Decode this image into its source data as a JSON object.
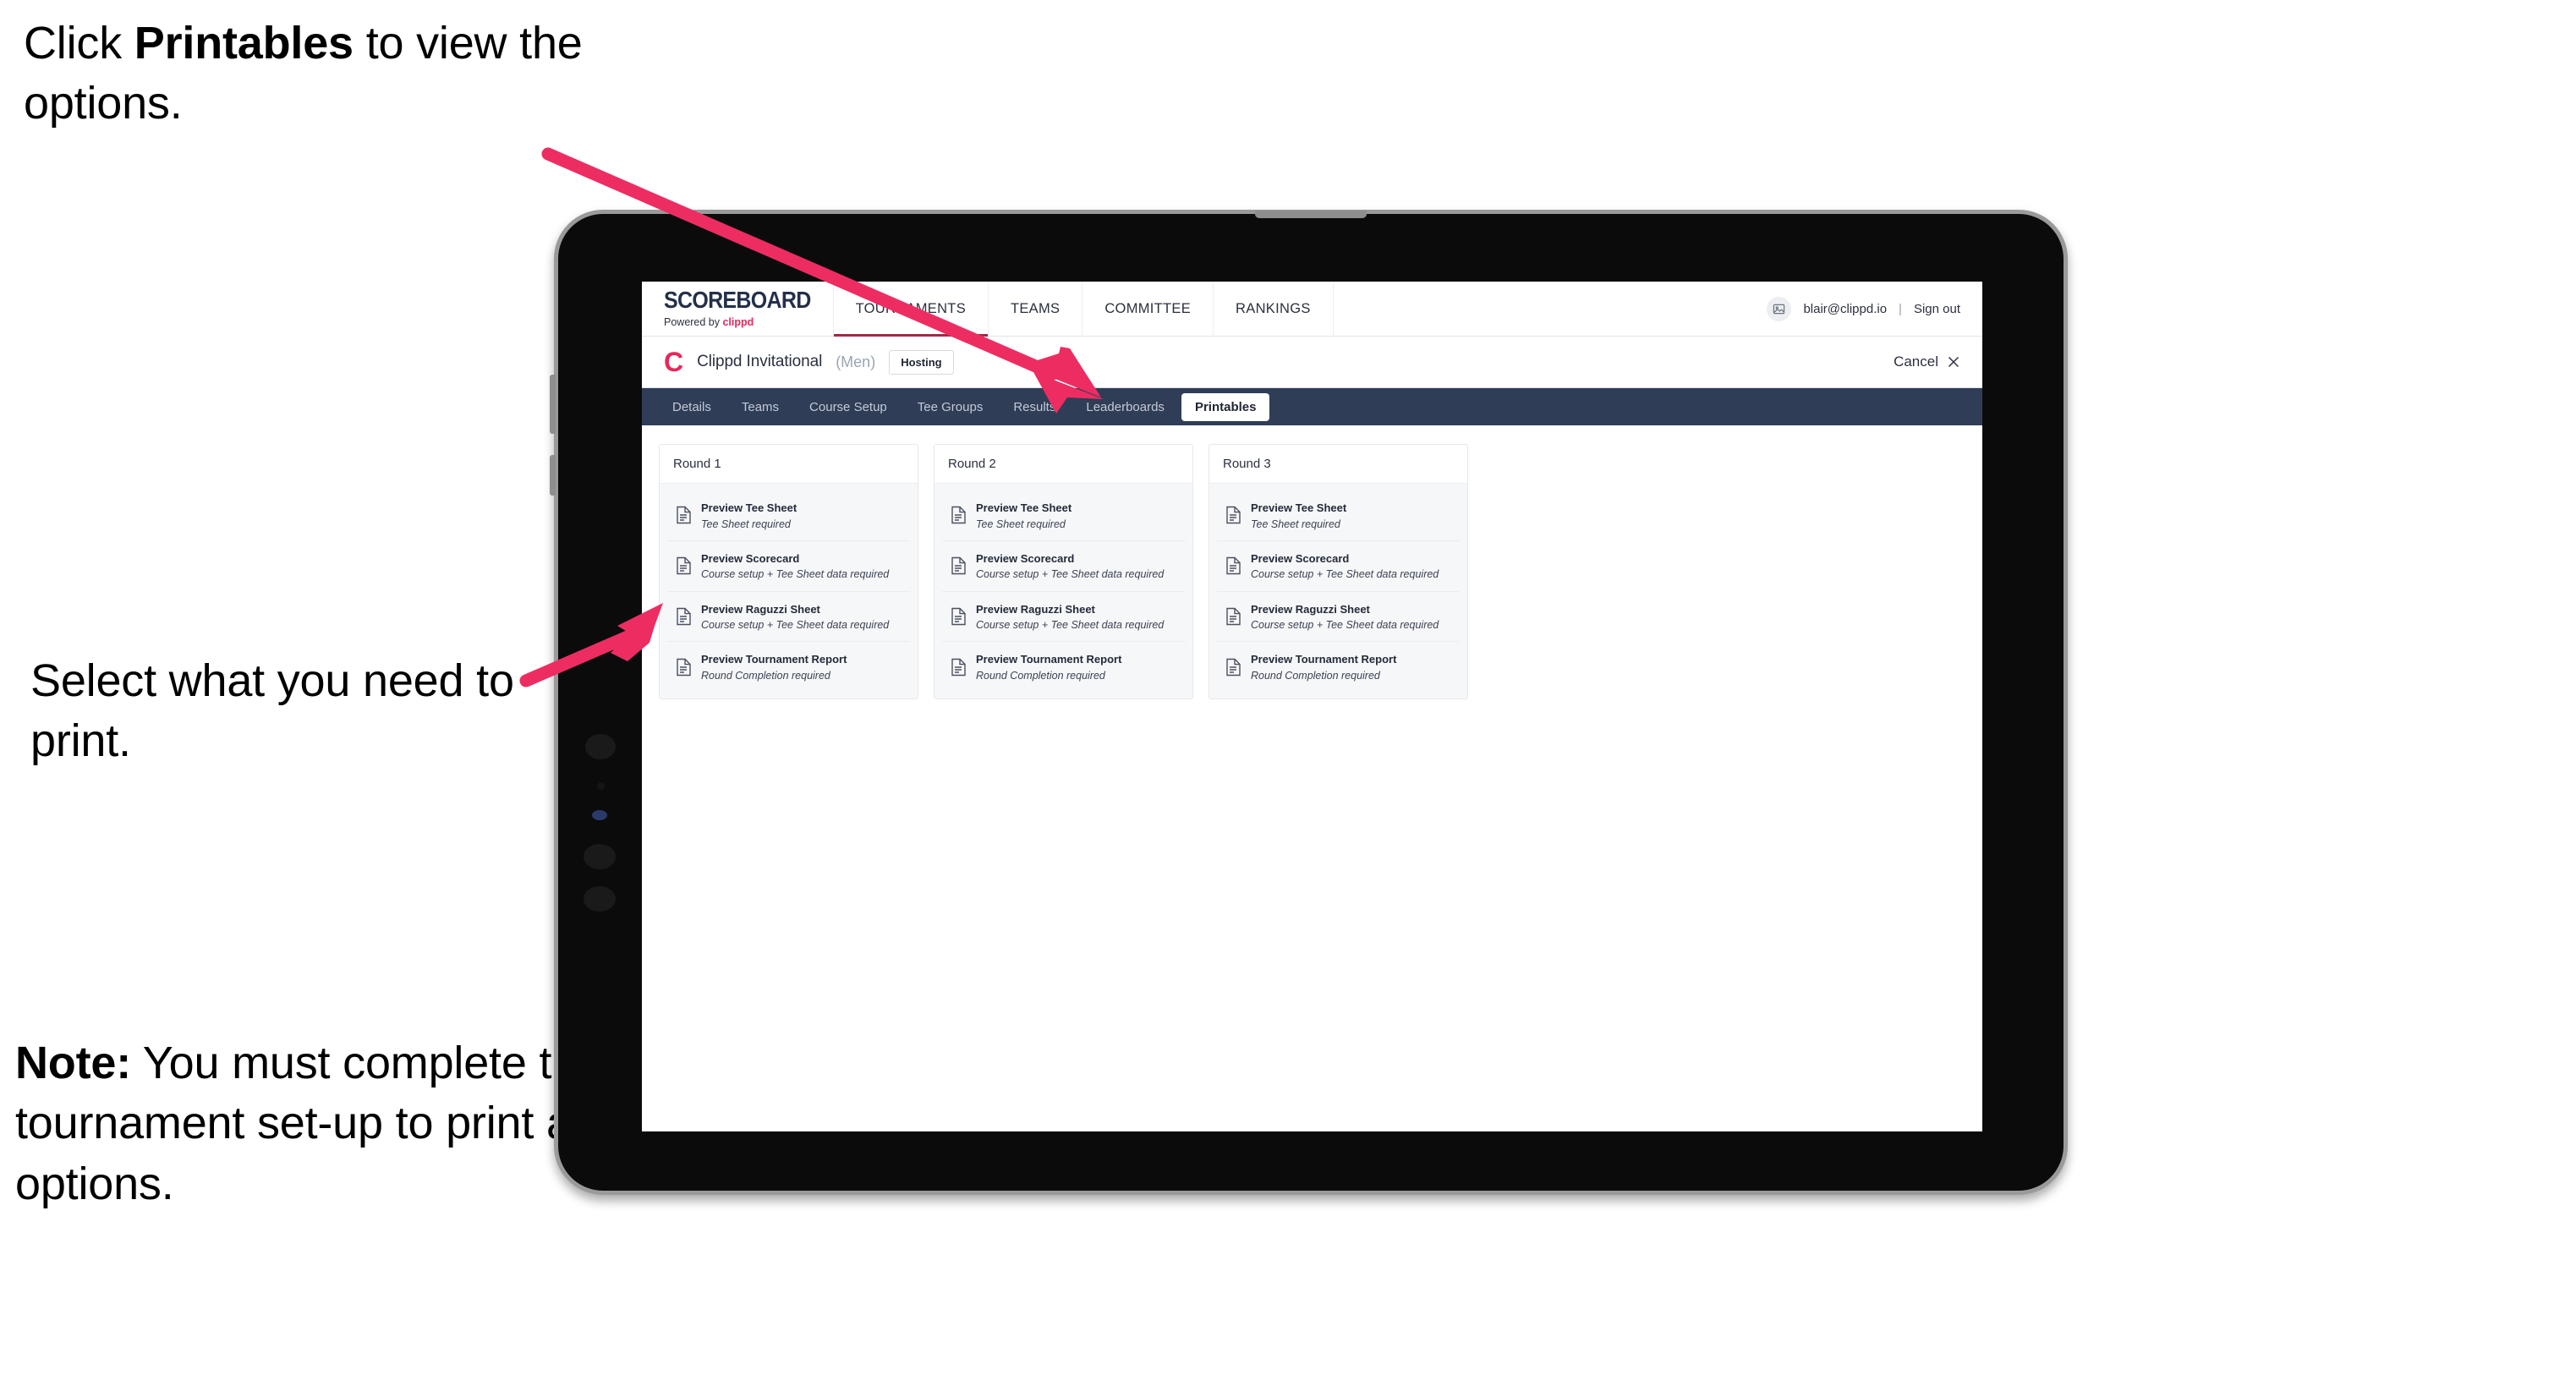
{
  "annotations": {
    "click_printables": {
      "prefix": "Click ",
      "bold": "Printables",
      "suffix": " to view the options."
    },
    "select_print": "Select what you need to print.",
    "note": {
      "bold": "Note:",
      "text": " You must complete the tournament set-up to print all the options."
    },
    "arrow_color": "#ED2D62"
  },
  "app": {
    "brand": {
      "title": "SCOREBOARD",
      "powered_prefix": "Powered by ",
      "powered_brand": "clippd"
    },
    "topnav": [
      {
        "label": "TOURNAMENTS",
        "active": true
      },
      {
        "label": "TEAMS",
        "active": false
      },
      {
        "label": "COMMITTEE",
        "active": false
      },
      {
        "label": "RANKINGS",
        "active": false
      }
    ],
    "account": {
      "email": "blair@clippd.io",
      "separator": "|",
      "sign_out": "Sign out"
    },
    "tournament": {
      "logo_letter": "C",
      "name": "Clippd Invitational",
      "gender": "(Men)",
      "status_badge": "Hosting",
      "cancel_label": "Cancel"
    },
    "tabs": [
      {
        "label": "Details",
        "active": false
      },
      {
        "label": "Teams",
        "active": false
      },
      {
        "label": "Course Setup",
        "active": false
      },
      {
        "label": "Tee Groups",
        "active": false
      },
      {
        "label": "Results",
        "active": false
      },
      {
        "label": "Leaderboards",
        "active": false
      },
      {
        "label": "Printables",
        "active": true
      }
    ],
    "rounds": [
      {
        "header": "Round 1",
        "items": [
          {
            "title": "Preview Tee Sheet",
            "sub": "Tee Sheet required"
          },
          {
            "title": "Preview Scorecard",
            "sub": "Course setup + Tee Sheet data required"
          },
          {
            "title": "Preview Raguzzi Sheet",
            "sub": "Course setup + Tee Sheet data required"
          },
          {
            "title": "Preview Tournament Report",
            "sub": "Round Completion required"
          }
        ]
      },
      {
        "header": "Round 2",
        "items": [
          {
            "title": "Preview Tee Sheet",
            "sub": "Tee Sheet required"
          },
          {
            "title": "Preview Scorecard",
            "sub": "Course setup + Tee Sheet data required"
          },
          {
            "title": "Preview Raguzzi Sheet",
            "sub": "Course setup + Tee Sheet data required"
          },
          {
            "title": "Preview Tournament Report",
            "sub": "Round Completion required"
          }
        ]
      },
      {
        "header": "Round 3",
        "items": [
          {
            "title": "Preview Tee Sheet",
            "sub": "Tee Sheet required"
          },
          {
            "title": "Preview Scorecard",
            "sub": "Course setup + Tee Sheet data required"
          },
          {
            "title": "Preview Raguzzi Sheet",
            "sub": "Course setup + Tee Sheet data required"
          },
          {
            "title": "Preview Tournament Report",
            "sub": "Round Completion required"
          }
        ]
      }
    ],
    "colors": {
      "tabstrip": "#2F3D57",
      "brand_pink": "#E8265A",
      "active_underline": "#9E2A47",
      "panel_bg": "#F6F7F9"
    }
  }
}
